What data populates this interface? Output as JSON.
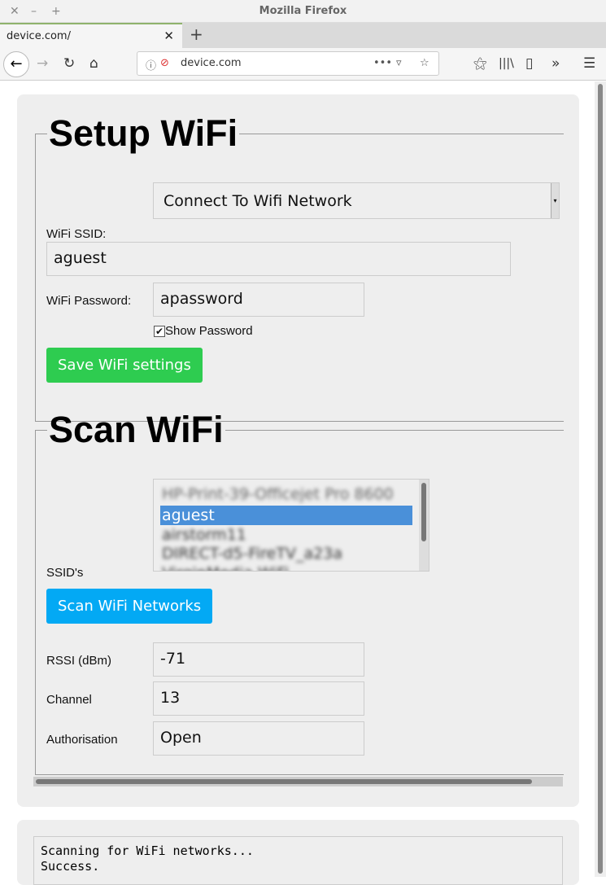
{
  "window": {
    "title": "Mozilla Firefox"
  },
  "tab": {
    "label": "device.com/"
  },
  "address": {
    "url": "device.com"
  },
  "setup": {
    "legend": "Setup WiFi",
    "mode_select": "Connect To Wifi Network",
    "ssid_label": "WiFi SSID:",
    "ssid_value": "aguest",
    "password_label": "WiFi Password:",
    "password_value": "apassword",
    "show_password_label": "Show Password",
    "show_password_checked": true,
    "save_button": "Save WiFi settings",
    "save_color": "#2ecc50"
  },
  "scan": {
    "legend": "Scan WiFi",
    "ssids_label": "SSID's",
    "networks": [
      "HP-Print-39-Officejet Pro 8600",
      "aguest",
      "airstorm11",
      "DIRECT-d5-FireTV_a23a",
      "VirginMedia WiFi"
    ],
    "selected_index": 1,
    "scan_button": "Scan WiFi Networks",
    "scan_color": "#03a9f4",
    "rssi_label": "RSSI (dBm)",
    "rssi_value": "-71",
    "channel_label": "Channel",
    "channel_value": "13",
    "auth_label": "Authorisation",
    "auth_value": "Open"
  },
  "log": {
    "text": "Scanning for WiFi networks...\nSuccess."
  }
}
